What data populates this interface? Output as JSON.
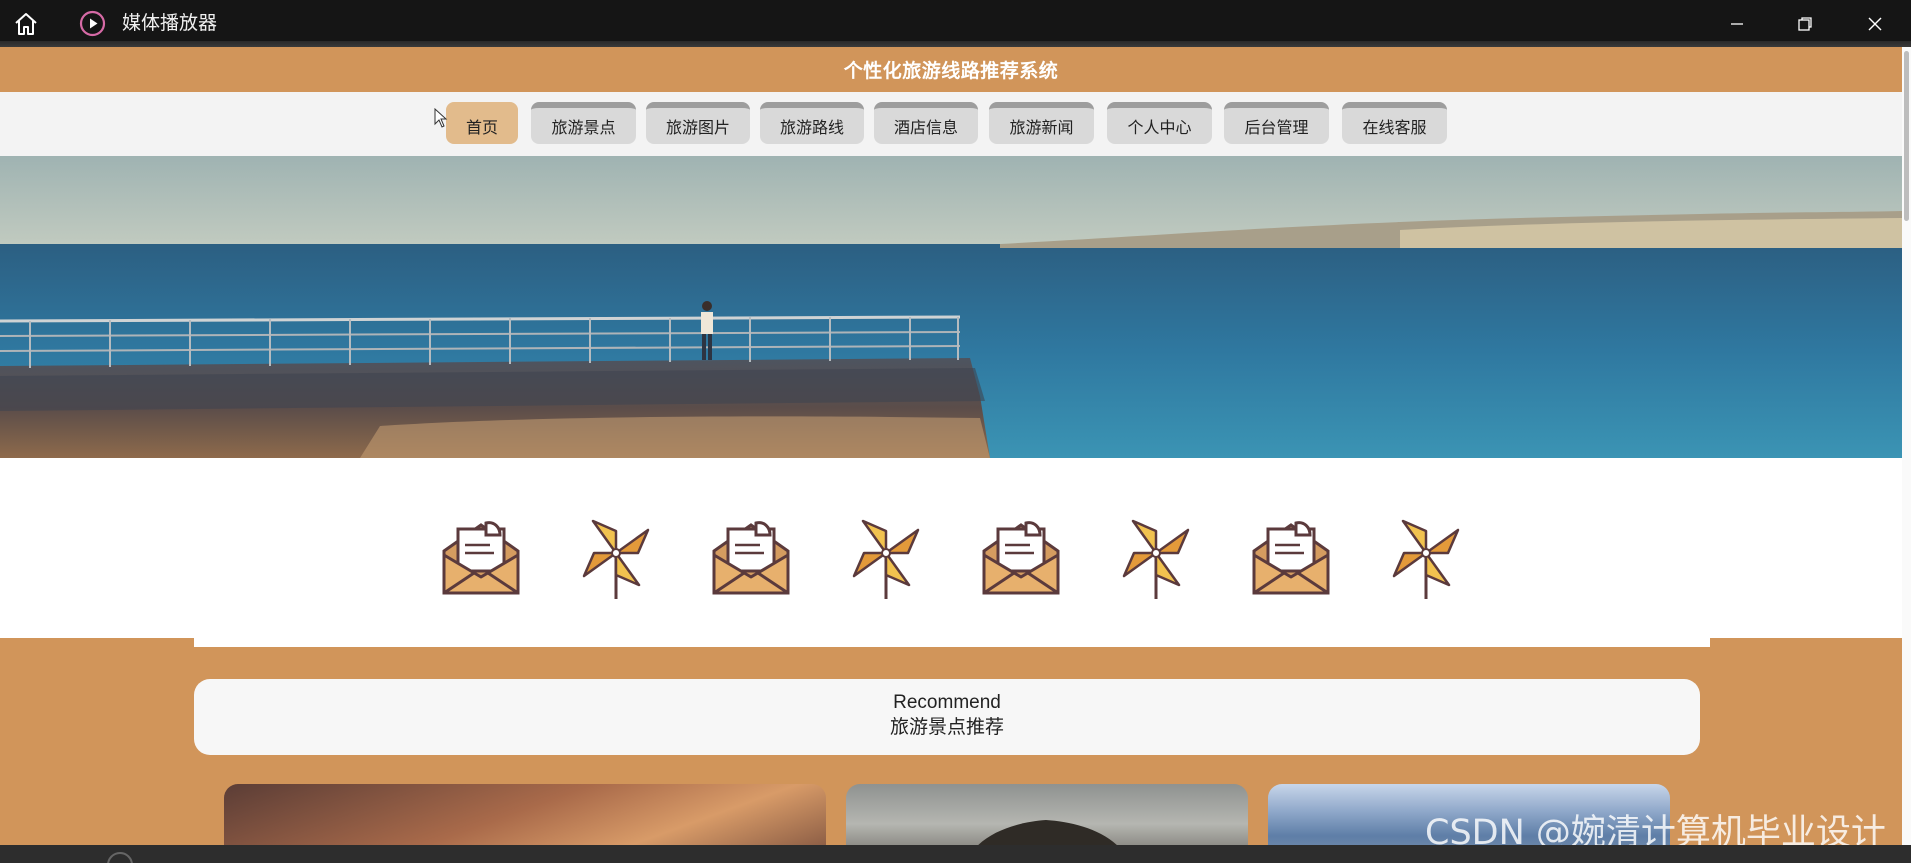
{
  "player": {
    "title": "媒体播放器",
    "icons": [
      "home-icon",
      "media-player-icon",
      "minimize-icon",
      "maximize-icon",
      "close-icon"
    ]
  },
  "site": {
    "title": "个性化旅游线路推荐系统",
    "nav": [
      {
        "label": "首页",
        "active": true
      },
      {
        "label": "旅游景点"
      },
      {
        "label": "旅游图片"
      },
      {
        "label": "旅游路线"
      },
      {
        "label": "酒店信息"
      },
      {
        "label": "旅游新闻"
      },
      {
        "label": "个人中心"
      },
      {
        "label": "后台管理"
      },
      {
        "label": "在线客服"
      }
    ],
    "decor_icons": [
      "envelope-icon",
      "pinwheel-icon",
      "envelope-icon",
      "pinwheel-icon",
      "envelope-icon",
      "pinwheel-icon",
      "envelope-icon",
      "pinwheel-icon"
    ],
    "recommend": {
      "en": "Recommend",
      "cn": "旅游景点推荐"
    }
  },
  "watermark": "CSDN @婉清计算机毕业设计",
  "colors": {
    "brand": "#d1955a",
    "nav_active": "#e2bb8c",
    "nav_bg": "#d9d9d9",
    "titlebar": "#151515"
  }
}
